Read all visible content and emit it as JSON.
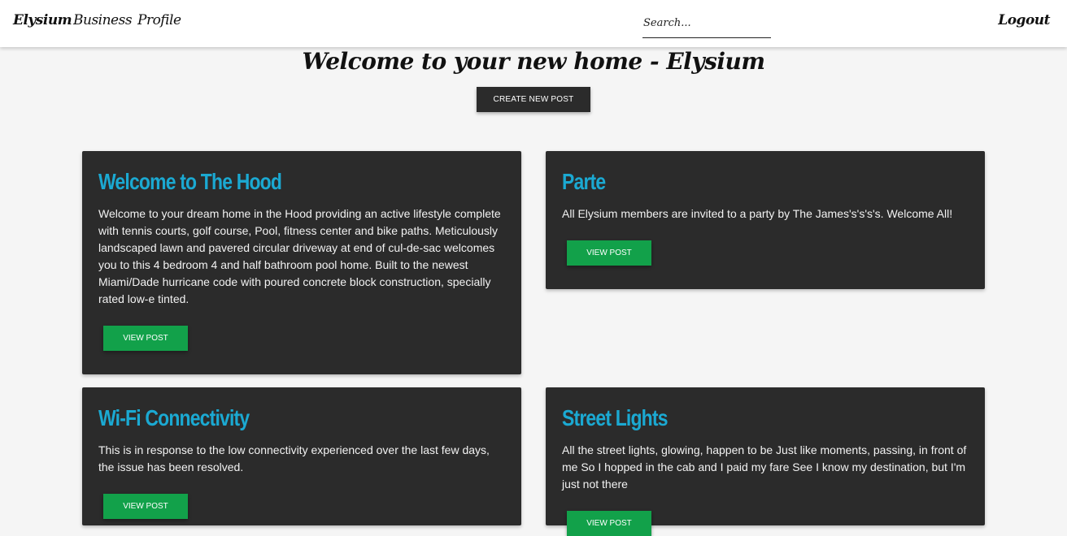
{
  "navbar": {
    "brand": "Elysium",
    "links": [
      "Business",
      "Profile"
    ],
    "search_placeholder": "Search...",
    "logout": "Logout"
  },
  "main": {
    "title": "Welcome to your new home - Elysium",
    "create_button": "CREATE NEW POST"
  },
  "posts": [
    {
      "title": "Welcome to The Hood",
      "body": "Welcome to your dream home in the Hood providing an active lifestyle complete with tennis courts, golf course, Pool, fitness center and bike paths. Meticulously landscaped lawn and pavered circular driveway at end of cul-de-sac welcomes you to this 4 bedroom 4 and half bathroom pool home. Built to the newest Miami/Dade hurricane code with poured concrete block construction, specially rated low-e tinted.",
      "button": "VIEW POST"
    },
    {
      "title": "Parte",
      "body": "All Elysium members are invited to a party by The James's's's's. Welcome All!",
      "button": "VIEW POST"
    },
    {
      "title": "Wi-Fi Connectivity",
      "body": "This is in response to the low connectivity experienced over the last few days, the issue has been resolved.",
      "button": "VIEW POST"
    },
    {
      "title": "Street Lights",
      "body": "All the street lights, glowing, happen to be Just like moments, passing, in front of me So I hopped in the cab and I paid my fare See I know my destination, but I'm just not there",
      "button": "VIEW POST"
    }
  ],
  "colors": {
    "navbar_bg": "#ffffff",
    "page_bg": "#f5f5f5",
    "card_bg": "#2b2b2b",
    "card_title": "#1ba9d2",
    "view_button": "#12a14a",
    "create_button": "#2b2b2b"
  }
}
